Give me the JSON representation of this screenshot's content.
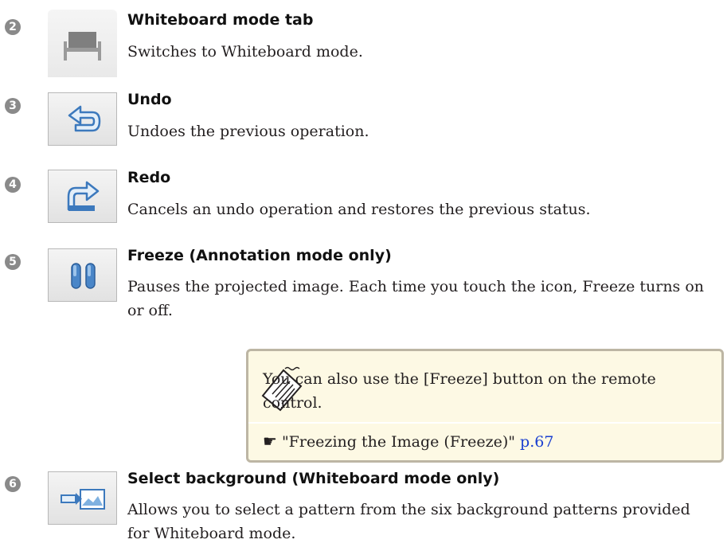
{
  "items": [
    {
      "num": "2",
      "title": "Whiteboard mode tab",
      "desc": "Switches to Whiteboard mode.",
      "icon": "whiteboard-tab-icon"
    },
    {
      "num": "3",
      "title": "Undo",
      "desc": "Undoes the previous operation.",
      "icon": "undo-icon"
    },
    {
      "num": "4",
      "title": "Redo",
      "desc": "Cancels an undo operation and restores the previous status.",
      "icon": "redo-icon"
    },
    {
      "num": "5",
      "title": "Freeze (Annotation mode only)",
      "desc": "Pauses the projected image. Each time you touch the icon, Freeze turns on or off.",
      "icon": "freeze-icon"
    },
    {
      "num": "6",
      "title": "Select background (Whiteboard mode only)",
      "desc": "Allows you to select a pattern from the six background patterns provided for Whiteboard mode.",
      "icon": "select-background-icon"
    }
  ],
  "note": {
    "text": "You can also use the [Freeze] button on the remote control.",
    "link_text": "\"Freezing the Image (Freeze)\"",
    "link_page": "p.67",
    "icon": "memo-note-icon"
  },
  "colors": {
    "link": "#1a3fd0",
    "note_bg": "#fdf9e4",
    "note_border": "#bdb6a4",
    "icon_blue": "#4a86c8"
  }
}
